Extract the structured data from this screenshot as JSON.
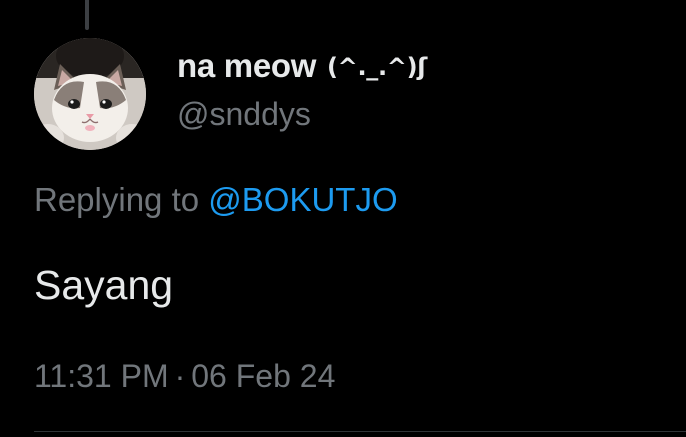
{
  "tweet": {
    "author": {
      "display_name": "na meow",
      "kaomoji": "(^._.^)ʃ",
      "handle": "@snddys",
      "avatar_icon": "cat-face-avatar"
    },
    "reply": {
      "prefix": "Replying to",
      "mention": "@BOKUTJO"
    },
    "text": "Sayang",
    "meta": {
      "time": "11:31 PM",
      "separator": "·",
      "date": "06 Feb 24"
    }
  },
  "colors": {
    "background": "#000000",
    "primary_text": "#e7e9ea",
    "secondary_text": "#71767b",
    "accent_link": "#1d9bf0",
    "divider": "#2f3336"
  }
}
